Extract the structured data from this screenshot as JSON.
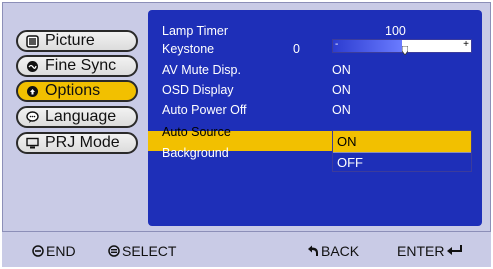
{
  "menu": {
    "items": [
      {
        "label": "Picture",
        "icon": "picture-icon"
      },
      {
        "label": "Fine Sync",
        "icon": "fine-sync-icon"
      },
      {
        "label": "Options",
        "icon": "options-icon",
        "active": true
      },
      {
        "label": "Language",
        "icon": "language-icon"
      },
      {
        "label": "PRJ Mode",
        "icon": "prj-mode-icon"
      }
    ]
  },
  "panel": {
    "lamp_timer": {
      "label": "Lamp Timer",
      "value": "100"
    },
    "keystone": {
      "label": "Keystone",
      "value": "0",
      "minus": "-",
      "plus": "+",
      "level": 0.5
    },
    "av_mute": {
      "label": "AV Mute Disp.",
      "value": "ON"
    },
    "osd_display": {
      "label": "OSD Display",
      "value": "ON"
    },
    "auto_power_off": {
      "label": "Auto Power Off",
      "value": "ON"
    },
    "auto_source": {
      "label": "Auto Source",
      "options": [
        "ON",
        "OFF"
      ],
      "selected": "ON"
    },
    "background": {
      "label": "Background"
    }
  },
  "footer": {
    "end": "END",
    "select": "SELECT",
    "back": "BACK",
    "enter": "ENTER"
  },
  "colors": {
    "panel_bg": "#1e2fb8",
    "highlight": "#f2c000",
    "frame": "#c9cbe6"
  }
}
